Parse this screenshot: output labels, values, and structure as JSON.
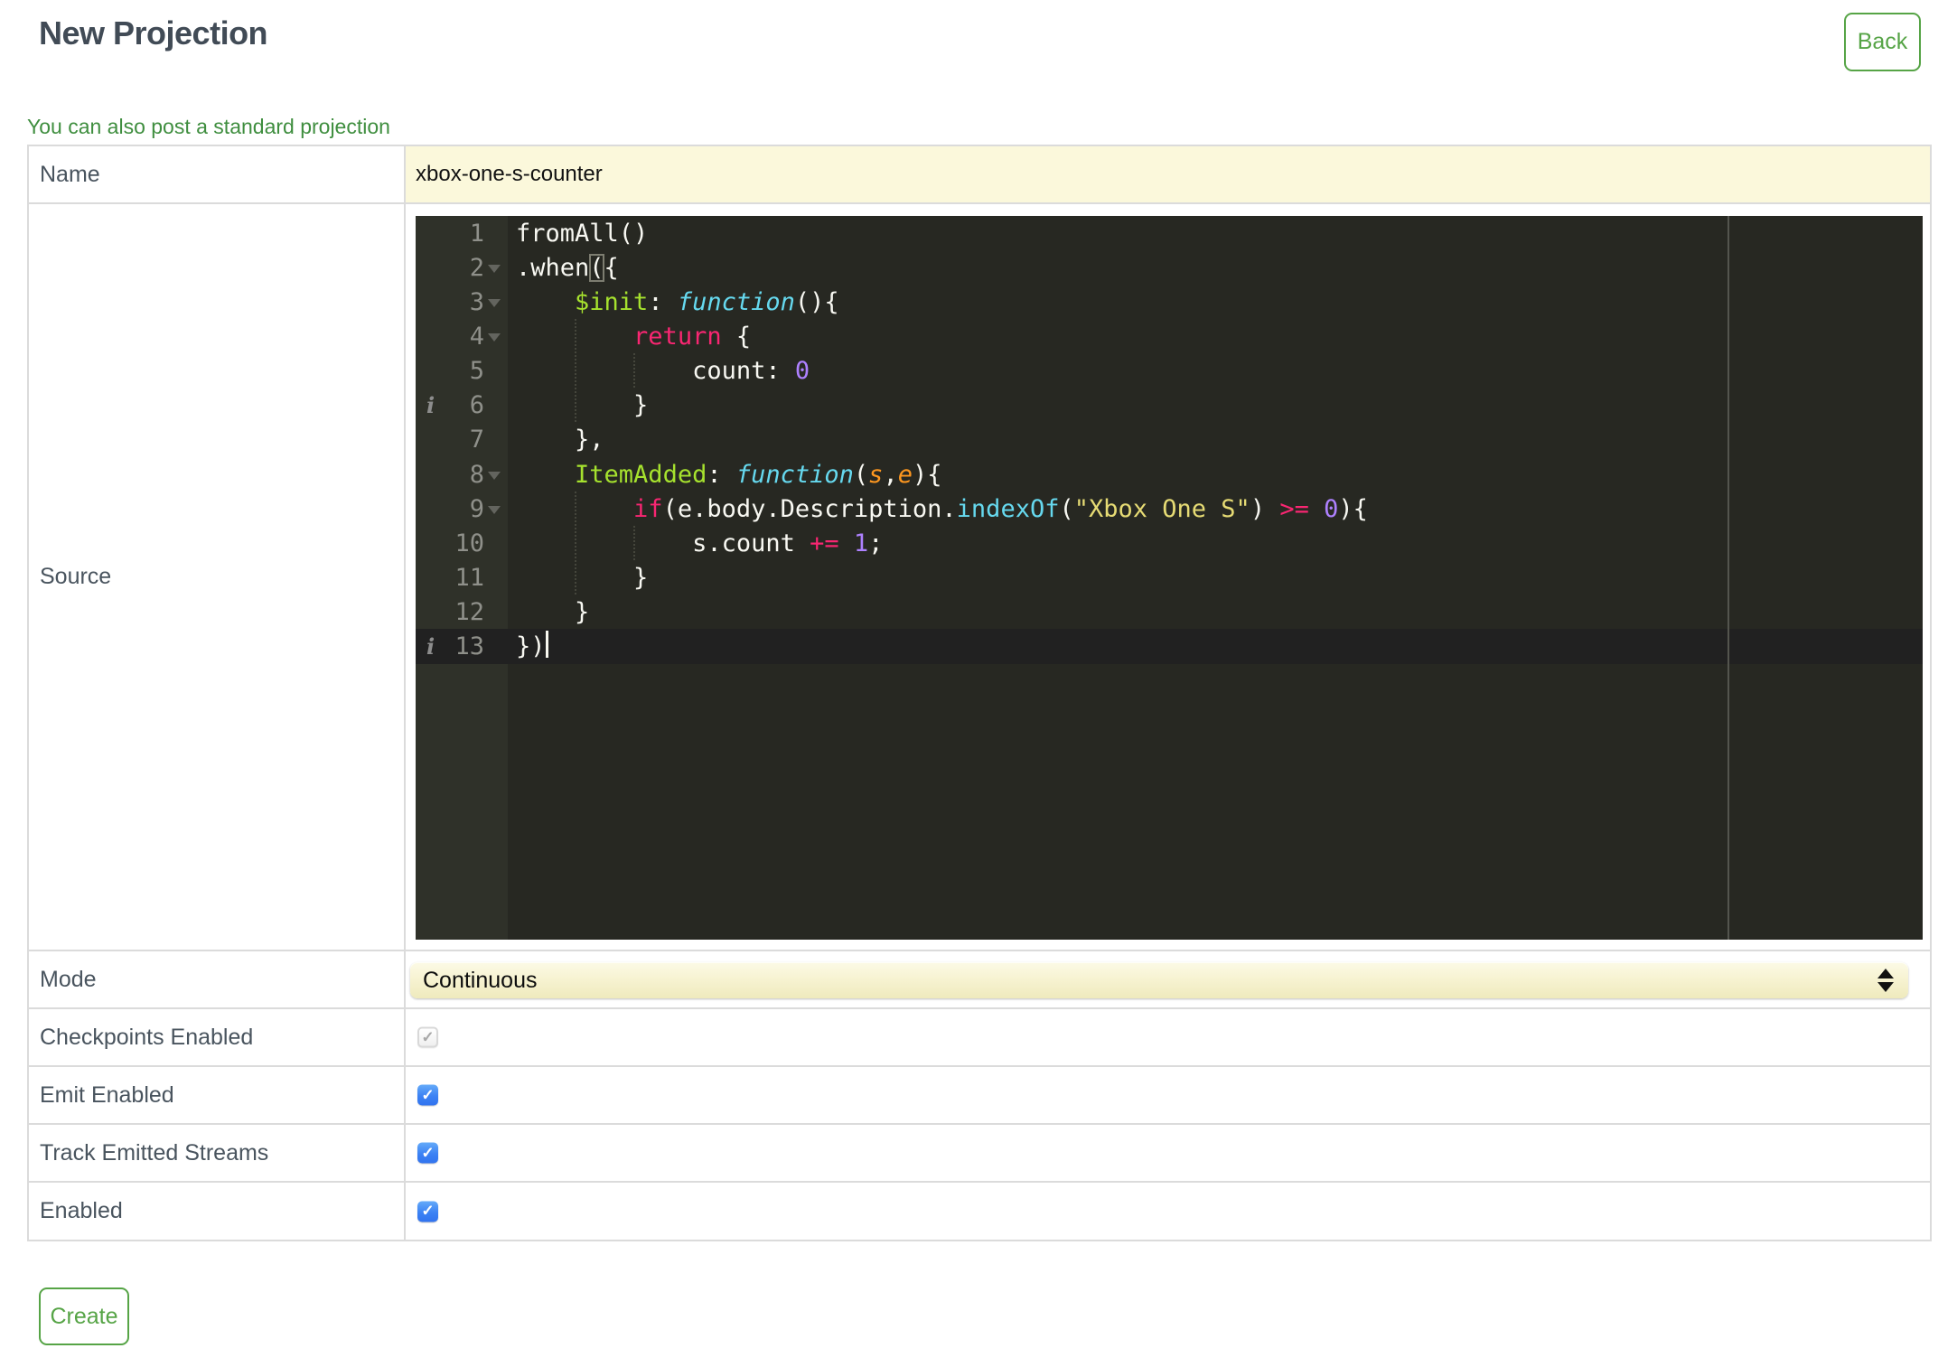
{
  "page": {
    "title": "New Projection"
  },
  "header": {
    "back_button": "Back"
  },
  "link": {
    "text": "You can also post a standard projection"
  },
  "form": {
    "rows": [
      {
        "label": "Name"
      },
      {
        "label": "Source"
      },
      {
        "label": "Mode"
      },
      {
        "label": "Checkpoints Enabled"
      },
      {
        "label": "Emit Enabled"
      },
      {
        "label": "Track Emitted Streams"
      },
      {
        "label": "Enabled"
      }
    ],
    "name_value": "xbox-one-s-counter",
    "mode_selected": "Continuous",
    "checkpoints_enabled": {
      "checked": true,
      "disabled": true
    },
    "emit_enabled": {
      "checked": true,
      "disabled": false
    },
    "track_emitted_streams": {
      "checked": true,
      "disabled": false
    },
    "enabled": {
      "checked": true,
      "disabled": false
    }
  },
  "icons": {
    "check": "✓"
  },
  "actions": {
    "create_button": "Create"
  },
  "colors": {
    "accent_green": "#56a446",
    "link_green": "#3f8e3f",
    "title_slate": "#414b56",
    "autofill_yellow": "#fbf8db",
    "checkbox_blue": "#3c82f4",
    "editor_background": "#272822",
    "editor_gutter": "#2f3129",
    "editor_active_line": "#212121",
    "token_keyword": "#f92672",
    "token_entity": "#a6e22e",
    "token_function": "#66d9ef",
    "token_number": "#ae81ff",
    "token_string": "#e6db74",
    "token_argument": "#fd971f"
  },
  "editor": {
    "language": "javascript",
    "cursor_line": 13,
    "source_text": "fromAll()\n.when({\n    $init: function(){\n        return {\n            count: 0\n        }\n    },\n    ItemAdded: function(s,e){\n        if(e.body.Description.indexOf(\"Xbox One S\") >= 0){\n            s.count += 1;\n        }\n    }\n})",
    "lines": [
      {
        "num": 1,
        "segs": [
          [
            "p",
            "fromAll()"
          ]
        ]
      },
      {
        "num": 2,
        "fold": true,
        "segs": [
          [
            "p",
            ".when"
          ],
          [
            "b",
            "("
          ],
          [
            "p",
            "{"
          ]
        ]
      },
      {
        "num": 3,
        "fold": true,
        "segs": [
          [
            "p",
            "    "
          ],
          [
            "g",
            "$init"
          ],
          [
            "p",
            ": "
          ],
          [
            "f",
            "function"
          ],
          [
            "p",
            "(){"
          ]
        ]
      },
      {
        "num": 4,
        "fold": true,
        "segs": [
          [
            "p",
            "        "
          ],
          [
            "k",
            "return"
          ],
          [
            "p",
            " {"
          ]
        ]
      },
      {
        "num": 5,
        "segs": [
          [
            "p",
            "            count: "
          ],
          [
            "n",
            "0"
          ]
        ]
      },
      {
        "num": 6,
        "info": true,
        "segs": [
          [
            "p",
            "        }"
          ]
        ]
      },
      {
        "num": 7,
        "segs": [
          [
            "p",
            "    },"
          ]
        ]
      },
      {
        "num": 8,
        "fold": true,
        "segs": [
          [
            "p",
            "    "
          ],
          [
            "g",
            "ItemAdded"
          ],
          [
            "p",
            ": "
          ],
          [
            "f",
            "function"
          ],
          [
            "p",
            "("
          ],
          [
            "a",
            "s"
          ],
          [
            "p",
            ","
          ],
          [
            "a",
            "e"
          ],
          [
            "p",
            "){"
          ]
        ]
      },
      {
        "num": 9,
        "fold": true,
        "segs": [
          [
            "p",
            "        "
          ],
          [
            "k",
            "if"
          ],
          [
            "p",
            "(e.body.Description."
          ],
          [
            "fn",
            "indexOf"
          ],
          [
            "p",
            "("
          ],
          [
            "s",
            "\"Xbox One S\""
          ],
          [
            "p",
            ") "
          ],
          [
            "k",
            ">="
          ],
          [
            "p",
            " "
          ],
          [
            "n",
            "0"
          ],
          [
            "p",
            "){"
          ]
        ]
      },
      {
        "num": 10,
        "segs": [
          [
            "p",
            "            s.count "
          ],
          [
            "k",
            "+="
          ],
          [
            "p",
            " "
          ],
          [
            "n",
            "1"
          ],
          [
            "p",
            ";"
          ]
        ]
      },
      {
        "num": 11,
        "segs": [
          [
            "p",
            "        }"
          ]
        ]
      },
      {
        "num": 12,
        "segs": [
          [
            "p",
            "    }"
          ]
        ]
      },
      {
        "num": 13,
        "info": true,
        "current": true,
        "cursor": true,
        "segs": [
          [
            "p",
            "})"
          ]
        ]
      }
    ],
    "indent_guides": [
      {
        "col": 4,
        "from_line": 4,
        "to_line": 6
      },
      {
        "col": 8,
        "from_line": 5,
        "to_line": 5
      },
      {
        "col": 4,
        "from_line": 9,
        "to_line": 11
      },
      {
        "col": 8,
        "from_line": 10,
        "to_line": 10
      }
    ]
  }
}
